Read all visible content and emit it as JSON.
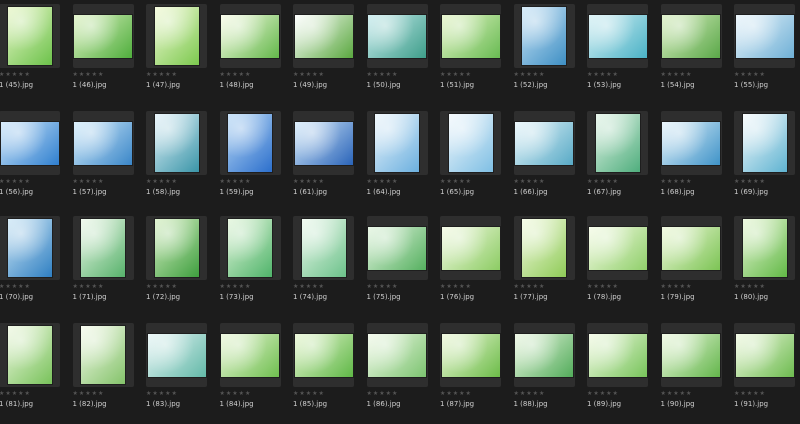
{
  "browser": {
    "rating_glyph": "★★★★★",
    "rows": [
      [
        {
          "file": "1 (45).jpg",
          "shape": "p",
          "c1": "#e9f7c9",
          "c2": "#6cc24a"
        },
        {
          "file": "1 (46).jpg",
          "shape": "l",
          "c1": "#dff2c4",
          "c2": "#4fae3c"
        },
        {
          "file": "1 (47).jpg",
          "shape": "p",
          "c1": "#f3fad8",
          "c2": "#7cc94e"
        },
        {
          "file": "1 (48).jpg",
          "shape": "l",
          "c1": "#fbfde9",
          "c2": "#63b84a"
        },
        {
          "file": "1 (49).jpg",
          "shape": "l",
          "c1": "#ffffff",
          "c2": "#5aa83f"
        },
        {
          "file": "1 (50).jpg",
          "shape": "l",
          "c1": "#c9ecef",
          "c2": "#3e9e8a"
        },
        {
          "file": "1 (51).jpg",
          "shape": "l",
          "c1": "#e6f5c8",
          "c2": "#68bb52"
        },
        {
          "file": "1 (52).jpg",
          "shape": "p",
          "c1": "#cde6f7",
          "c2": "#3e8fc4"
        },
        {
          "file": "1 (53).jpg",
          "shape": "l",
          "c1": "#d8f1f5",
          "c2": "#4ab2c6"
        },
        {
          "file": "1 (54).jpg",
          "shape": "l",
          "c1": "#dbefc3",
          "c2": "#5aa848"
        },
        {
          "file": "1 (55).jpg",
          "shape": "l",
          "c1": "#eaf5fb",
          "c2": "#6fb0d6"
        }
      ],
      [
        {
          "file": "1 (56).jpg",
          "shape": "l",
          "c1": "#cfe7fa",
          "c2": "#2f7fcf"
        },
        {
          "file": "1 (57).jpg",
          "shape": "l",
          "c1": "#d6eefc",
          "c2": "#3a86c8"
        },
        {
          "file": "1 (58).jpg",
          "shape": "p",
          "c1": "#e5f3fa",
          "c2": "#3a95a8"
        },
        {
          "file": "1 (59).jpg",
          "shape": "p",
          "c1": "#bcdcf7",
          "c2": "#2c6fcc"
        },
        {
          "file": "1 (61).jpg",
          "shape": "l",
          "c1": "#d7ecfb",
          "c2": "#2a64b9"
        },
        {
          "file": "1 (64).jpg",
          "shape": "p",
          "c1": "#edf6fc",
          "c2": "#6cb0df"
        },
        {
          "file": "1 (65).jpg",
          "shape": "p",
          "c1": "#f3f9fd",
          "c2": "#7fbfe4"
        },
        {
          "file": "1 (66).jpg",
          "shape": "l",
          "c1": "#e8f6fb",
          "c2": "#58aac6"
        },
        {
          "file": "1 (67).jpg",
          "shape": "p",
          "c1": "#e4f4e8",
          "c2": "#4fae7d"
        },
        {
          "file": "1 (68).jpg",
          "shape": "l",
          "c1": "#e6f4fb",
          "c2": "#3f93c8"
        },
        {
          "file": "1 (69).jpg",
          "shape": "p",
          "c1": "#f7fbfd",
          "c2": "#5fb3d1"
        }
      ],
      [
        {
          "file": "1 (70).jpg",
          "shape": "p",
          "c1": "#cfe8f6",
          "c2": "#2f7fc2"
        },
        {
          "file": "1 (71).jpg",
          "shape": "p",
          "c1": "#eef8ea",
          "c2": "#57b26b"
        },
        {
          "file": "1 (72).jpg",
          "shape": "p",
          "c1": "#d9f0c6",
          "c2": "#3e9f3e"
        },
        {
          "file": "1 (73).jpg",
          "shape": "p",
          "c1": "#e4f6dc",
          "c2": "#4fb46a"
        },
        {
          "file": "1 (74).jpg",
          "shape": "p",
          "c1": "#eef9ee",
          "c2": "#6cc28a"
        },
        {
          "file": "1 (75).jpg",
          "shape": "l",
          "c1": "#e6f6e3",
          "c2": "#55b05f"
        },
        {
          "file": "1 (76).jpg",
          "shape": "l",
          "c1": "#f5fbe6",
          "c2": "#8ccc63"
        },
        {
          "file": "1 (77).jpg",
          "shape": "p",
          "c1": "#f4fbe3",
          "c2": "#8fcb57"
        },
        {
          "file": "1 (78).jpg",
          "shape": "l",
          "c1": "#f6fce8",
          "c2": "#90cf6a"
        },
        {
          "file": "1 (79).jpg",
          "shape": "l",
          "c1": "#f0f9dc",
          "c2": "#7cc454"
        },
        {
          "file": "1 (80).jpg",
          "shape": "p",
          "c1": "#e9f7d8",
          "c2": "#62b946"
        }
      ],
      [
        {
          "file": "1 (81).jpg",
          "shape": "p",
          "c1": "#f1f9e4",
          "c2": "#78c25a"
        },
        {
          "file": "1 (82).jpg",
          "shape": "p",
          "c1": "#f7fbee",
          "c2": "#84c36a"
        },
        {
          "file": "1 (83).jpg",
          "shape": "l",
          "c1": "#e9f6f7",
          "c2": "#63b9a8"
        },
        {
          "file": "1 (84).jpg",
          "shape": "l",
          "c1": "#eef8dd",
          "c2": "#6fbf4f"
        },
        {
          "file": "1 (85).jpg",
          "shape": "l",
          "c1": "#eaf7d5",
          "c2": "#5fb846"
        },
        {
          "file": "1 (86).jpg",
          "shape": "l",
          "c1": "#f3faeb",
          "c2": "#7cc470"
        },
        {
          "file": "1 (87).jpg",
          "shape": "l",
          "c1": "#f0f9dc",
          "c2": "#6cbc48"
        },
        {
          "file": "1 (88).jpg",
          "shape": "l",
          "c1": "#eef8e4",
          "c2": "#52ac5a"
        },
        {
          "file": "1 (89).jpg",
          "shape": "l",
          "c1": "#f4fbe6",
          "c2": "#77c45a"
        },
        {
          "file": "1 (90).jpg",
          "shape": "l",
          "c1": "#eff9e1",
          "c2": "#63b64b"
        },
        {
          "file": "1 (91).jpg",
          "shape": "l",
          "c1": "#f2fae3",
          "c2": "#6dbb4f"
        }
      ]
    ]
  }
}
